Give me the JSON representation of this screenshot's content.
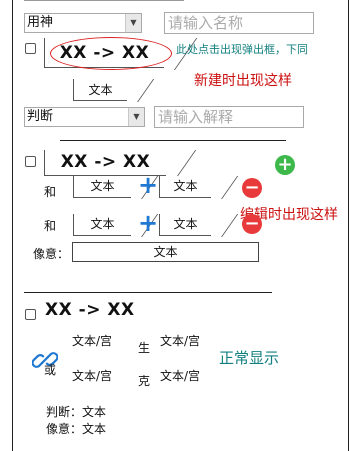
{
  "new_form": {
    "type_select_value": "用神",
    "name_placeholder": "请输入名称",
    "main_tab_label": "XX -> XX",
    "popup_hint": "此处点击出现弹出框，下同",
    "new_note": "新建时出现这样",
    "text_tab_label": "文本",
    "judge_select_value": "判断",
    "desc_placeholder": "请输入解释"
  },
  "edit_form": {
    "main_tab_label": "XX -> XX",
    "he_label_1": "和",
    "he_label_2": "和",
    "row1_text_a": "文本",
    "row1_text_b": "文本",
    "row2_text_a": "文本",
    "row2_text_b": "文本",
    "xiangyi_label": "像意：",
    "xiangyi_value": "文本",
    "edit_note": "编辑时出现这样"
  },
  "display_view": {
    "title": "XX -> XX",
    "or_label": "或",
    "left_top": "文本/宫",
    "left_bottom": "文本/宫",
    "sheng": "生",
    "ke": "克",
    "right_top": "文本/宫",
    "right_bottom": "文本/宫",
    "normal_note": "正常显示",
    "judge_line": "判断：文本",
    "xiangyi_line": "像意：文本"
  },
  "colors": {
    "note_red": "#cc1111",
    "note_teal": "#127f7f",
    "plus_blue": "#1f78d1",
    "add_green": "#3cb94a",
    "remove_red": "#e83a3a"
  }
}
